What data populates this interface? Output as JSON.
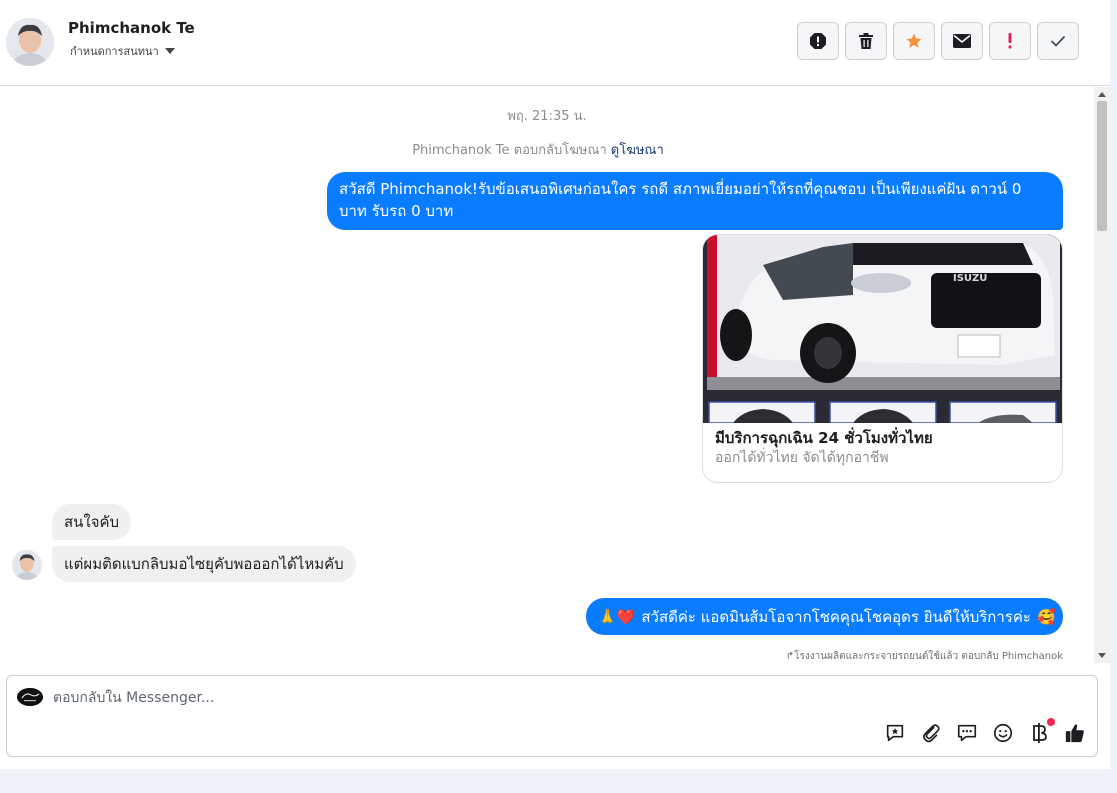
{
  "header": {
    "contact_name": "Phimchanok Te",
    "assign_label": "กำหนดการสนทนา",
    "toolbar": [
      {
        "icon": "alert-octagon-icon",
        "label": "spam"
      },
      {
        "icon": "trash-icon",
        "label": "delete"
      },
      {
        "icon": "star-icon",
        "label": "star"
      },
      {
        "icon": "envelope-icon",
        "label": "mark-unread"
      },
      {
        "icon": "exclamation-icon",
        "label": "follow-up"
      },
      {
        "icon": "check-icon",
        "label": "done"
      }
    ]
  },
  "thread": {
    "timestamp": "พฤ. 21:35 น.",
    "ad_reply_text": "Phimchanok Te ตอบกลับโฆษณา",
    "ad_reply_link": "ดูโฆษณา",
    "messages": [
      {
        "direction": "out",
        "text": "สวัสดี Phimchanok!รับข้อเสนอพิเศษก่อนใคร รถดี สภาพเยี่ยมอย่าให้รถที่คุณชอบ เป็นเพียงแค่ฝัน ดาวน์ 0 บาท รับรถ 0 บาท"
      },
      {
        "direction": "in",
        "text": "สนใจคับ"
      },
      {
        "direction": "in",
        "text": "แต่ผมติดแบกลิบมอไซยุคับพอออกได้ไหมคับ"
      },
      {
        "direction": "out",
        "emoji_prefix": "🙏❤️",
        "text": "สวัสดีค่ะ แอดมินส้มโอจากโชคคุณโชคอุดร ยินดีให้บริการค่ะ",
        "emoji_suffix": "🥰"
      }
    ],
    "ad_card": {
      "image_brand": "ISUZU",
      "title": "มีบริการฉุกเฉิน 24 ชั่วโมงทั่วไทย",
      "subtitle": "ออกได้ทั่วไทย จัดได้ทุกอาชีพ"
    },
    "sent_by": "↱โรงงานผลิตและกระจายรถยนต์ใช้แล้ว ตอบกลับ Phimchanok"
  },
  "composer": {
    "placeholder": "ตอบกลับใน Messenger...",
    "tools": [
      "saved-reply-icon",
      "paperclip-icon",
      "chat-bubbles-icon",
      "emoji-icon",
      "baht-icon",
      "thumbs-up-icon"
    ]
  },
  "colors": {
    "outgoing_bubble": "#0a7cff",
    "incoming_bubble": "#f0f0f0",
    "star": "#f7923a",
    "alert_red": "#e0245e"
  }
}
